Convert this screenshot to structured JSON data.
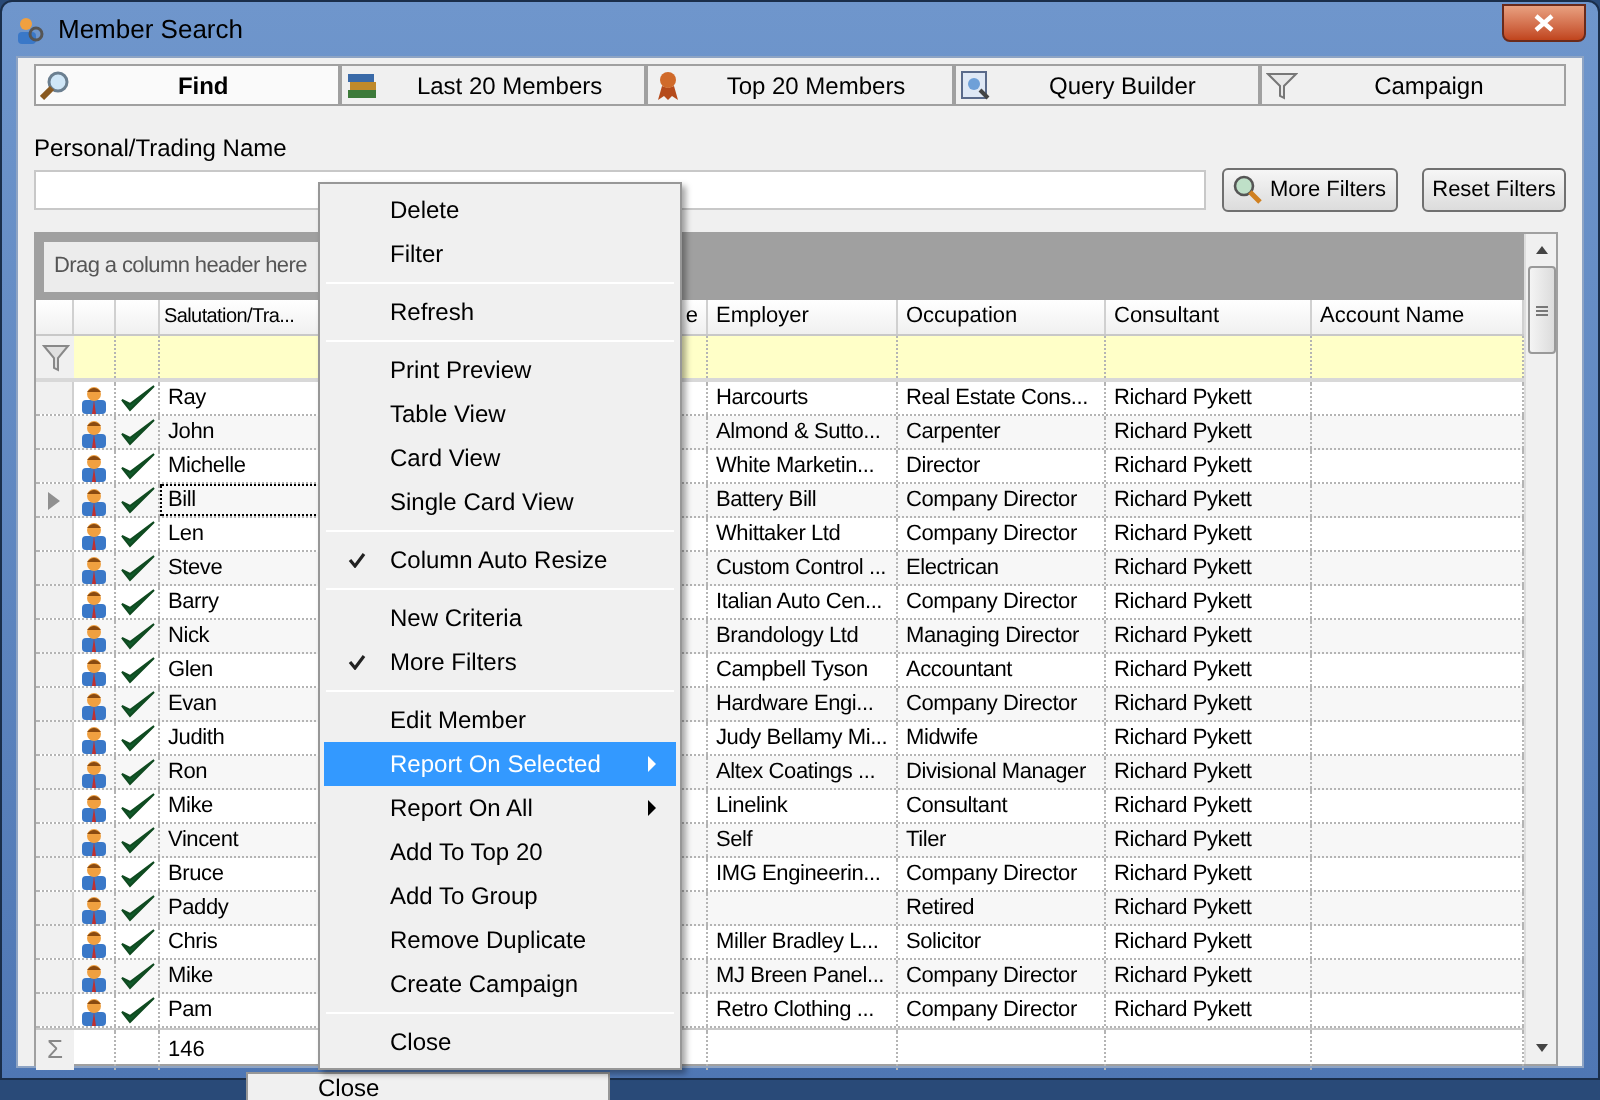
{
  "window": {
    "title": "Member Search"
  },
  "tabs": [
    {
      "label": "Find",
      "selected": true
    },
    {
      "label": "Last 20 Members",
      "selected": false
    },
    {
      "label": "Top 20 Members",
      "selected": false
    },
    {
      "label": "Query Builder",
      "selected": false
    },
    {
      "label": "Campaign",
      "selected": false
    }
  ],
  "search": {
    "label": "Personal/Trading Name"
  },
  "buttons": [
    {
      "label": "More Filters"
    },
    {
      "label": "Reset Filters"
    }
  ],
  "grid": {
    "group_hint": "Drag a column header here",
    "columns": [
      "",
      "",
      "",
      "Salutation/Tra...",
      "e",
      "Employer",
      "Occupation",
      "Consultant",
      "Account Name"
    ],
    "rows": [
      {
        "name": "Ray",
        "employer": "Harcourts",
        "occupation": "Real Estate Cons...",
        "consultant": "Richard Pykett",
        "selected": false
      },
      {
        "name": "John",
        "employer": "Almond & Sutto...",
        "occupation": "Carpenter",
        "consultant": "Richard Pykett",
        "selected": false
      },
      {
        "name": "Michelle",
        "employer": "White Marketin...",
        "occupation": "Director",
        "consultant": "Richard Pykett",
        "selected": false
      },
      {
        "name": "Bill",
        "employer": "Battery Bill",
        "occupation": "Company Director",
        "consultant": "Richard Pykett",
        "selected": true
      },
      {
        "name": "Len",
        "employer": "Whittaker Ltd",
        "occupation": "Company Director",
        "consultant": "Richard Pykett",
        "selected": false
      },
      {
        "name": "Steve",
        "employer": "Custom Control ...",
        "occupation": "Electrican",
        "consultant": "Richard Pykett",
        "selected": false
      },
      {
        "name": "Barry",
        "employer": "Italian Auto Cen...",
        "occupation": "Company Director",
        "consultant": "Richard Pykett",
        "selected": false
      },
      {
        "name": "Nick",
        "employer": "Brandology Ltd",
        "occupation": "Managing Director",
        "consultant": "Richard Pykett",
        "selected": false
      },
      {
        "name": "Glen",
        "employer": "Campbell Tyson",
        "occupation": "Accountant",
        "consultant": "Richard Pykett",
        "selected": false
      },
      {
        "name": "Evan",
        "employer": "Hardware Engi...",
        "occupation": "Company Director",
        "consultant": "Richard Pykett",
        "selected": false
      },
      {
        "name": "Judith",
        "employer": "Judy Bellamy Mi...",
        "occupation": "Midwife",
        "consultant": "Richard Pykett",
        "selected": false
      },
      {
        "name": "Ron",
        "employer": "Altex Coatings ...",
        "occupation": "Divisional Manager",
        "consultant": "Richard Pykett",
        "selected": false
      },
      {
        "name": "Mike",
        "employer": "Linelink",
        "occupation": "Consultant",
        "consultant": "Richard Pykett",
        "selected": false
      },
      {
        "name": "Vincent",
        "employer": "Self",
        "occupation": "Tiler",
        "consultant": "Richard Pykett",
        "selected": false
      },
      {
        "name": "Bruce",
        "employer": "IMG Engineerin...",
        "occupation": "Company Director",
        "consultant": "Richard Pykett",
        "selected": false
      },
      {
        "name": "Paddy",
        "employer": "",
        "occupation": "Retired",
        "consultant": "Richard Pykett",
        "selected": false
      },
      {
        "name": "Chris",
        "employer": "Miller Bradley L...",
        "occupation": "Solicitor",
        "consultant": "Richard Pykett",
        "selected": false
      },
      {
        "name": "Mike",
        "employer": "MJ Breen Panel...",
        "occupation": "Company Director",
        "consultant": "Richard Pykett",
        "selected": false
      },
      {
        "name": "Pam",
        "employer": "Retro Clothing ...",
        "occupation": "Company Director",
        "consultant": "Richard Pykett",
        "selected": false
      }
    ],
    "footer_symbol": "Σ",
    "footer_count": "146"
  },
  "context_menu": [
    {
      "kind": "item",
      "label": "Delete",
      "checked": false,
      "selected": false,
      "submenu": false
    },
    {
      "kind": "item",
      "label": "Filter",
      "checked": false,
      "selected": false,
      "submenu": false
    },
    {
      "kind": "separator"
    },
    {
      "kind": "item",
      "label": "Refresh",
      "checked": false,
      "selected": false,
      "submenu": false
    },
    {
      "kind": "separator"
    },
    {
      "kind": "item",
      "label": "Print Preview",
      "checked": false,
      "selected": false,
      "submenu": false
    },
    {
      "kind": "item",
      "label": "Table View",
      "checked": false,
      "selected": false,
      "submenu": false
    },
    {
      "kind": "item",
      "label": "Card View",
      "checked": false,
      "selected": false,
      "submenu": false
    },
    {
      "kind": "item",
      "label": "Single Card View",
      "checked": false,
      "selected": false,
      "submenu": false
    },
    {
      "kind": "separator"
    },
    {
      "kind": "item",
      "label": "Column Auto Resize",
      "checked": true,
      "selected": false,
      "submenu": false
    },
    {
      "kind": "separator"
    },
    {
      "kind": "item",
      "label": "New Criteria",
      "checked": false,
      "selected": false,
      "submenu": false
    },
    {
      "kind": "item",
      "label": "More Filters",
      "checked": true,
      "selected": false,
      "submenu": false
    },
    {
      "kind": "separator"
    },
    {
      "kind": "item",
      "label": "Edit Member",
      "checked": false,
      "selected": false,
      "submenu": false
    },
    {
      "kind": "item",
      "label": "Report On Selected",
      "checked": false,
      "selected": true,
      "submenu": true
    },
    {
      "kind": "item",
      "label": "Report On All",
      "checked": false,
      "selected": false,
      "submenu": true
    },
    {
      "kind": "item",
      "label": "Add To Top 20",
      "checked": false,
      "selected": false,
      "submenu": false
    },
    {
      "kind": "item",
      "label": "Add To Group",
      "checked": false,
      "selected": false,
      "submenu": false
    },
    {
      "kind": "item",
      "label": "Remove Duplicate",
      "checked": false,
      "selected": false,
      "submenu": false
    },
    {
      "kind": "item",
      "label": "Create Campaign",
      "checked": false,
      "selected": false,
      "submenu": false
    },
    {
      "kind": "separator"
    },
    {
      "kind": "item",
      "label": "Close",
      "checked": false,
      "selected": false,
      "submenu": false
    }
  ],
  "background_menu": {
    "item": "Close"
  }
}
